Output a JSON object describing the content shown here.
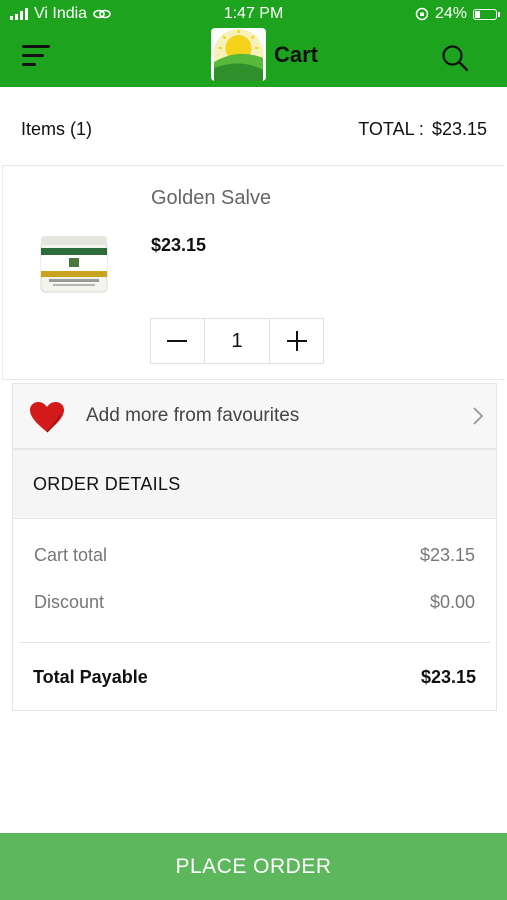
{
  "status_bar": {
    "carrier": "Vi India",
    "time": "1:47 PM",
    "battery": "24%"
  },
  "nav": {
    "title": "Cart",
    "icons": [
      "menu-icon",
      "app-logo",
      "search-icon"
    ]
  },
  "summary": {
    "items_label": "Items (1)",
    "total_label": "TOTAL :",
    "total_value": "$23.15"
  },
  "product": {
    "name": "Golden Salve",
    "price": "$23.15",
    "quantity": "1",
    "image_icon": "golden-salve-jar"
  },
  "favourites": {
    "label": "Add more from favourites",
    "icon": "heart-icon"
  },
  "order_details": {
    "title": "ORDER DETAILS",
    "cart_total_label": "Cart total",
    "cart_total_value": "$23.15",
    "discount_label": "Discount",
    "discount_value": "$0.00",
    "total_payable_label": "Total Payable",
    "total_payable_value": "$23.15"
  },
  "actions": {
    "place_order": "PLACE ORDER"
  },
  "colors": {
    "header_green": "#1ea31e",
    "button_green": "#5db85d",
    "heart_red": "#d31a1a"
  }
}
